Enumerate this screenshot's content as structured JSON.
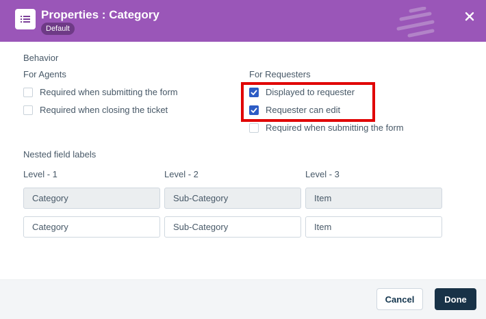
{
  "header": {
    "title": "Properties : Category",
    "badge": "Default",
    "icon": "list-icon",
    "close_icon": "close-icon",
    "bg_color": "#9a56b8"
  },
  "behavior": {
    "title": "Behavior",
    "agents": {
      "title": "For Agents",
      "items": [
        {
          "label": "Required when submitting the form",
          "checked": false
        },
        {
          "label": "Required when closing the ticket",
          "checked": false
        }
      ]
    },
    "requesters": {
      "title": "For Requesters",
      "items": [
        {
          "label": "Displayed to requester",
          "checked": true
        },
        {
          "label": "Requester can edit",
          "checked": true
        },
        {
          "label": "Required when submitting the form",
          "checked": false
        }
      ]
    }
  },
  "nested": {
    "title": "Nested field labels",
    "levels": [
      {
        "label": "Level - 1",
        "agent_value": "Category",
        "requester_value": "Category"
      },
      {
        "label": "Level - 2",
        "agent_value": "Sub-Category",
        "requester_value": "Sub-Category"
      },
      {
        "label": "Level - 3",
        "agent_value": "Item",
        "requester_value": "Item"
      }
    ]
  },
  "footer": {
    "cancel_label": "Cancel",
    "done_label": "Done"
  }
}
